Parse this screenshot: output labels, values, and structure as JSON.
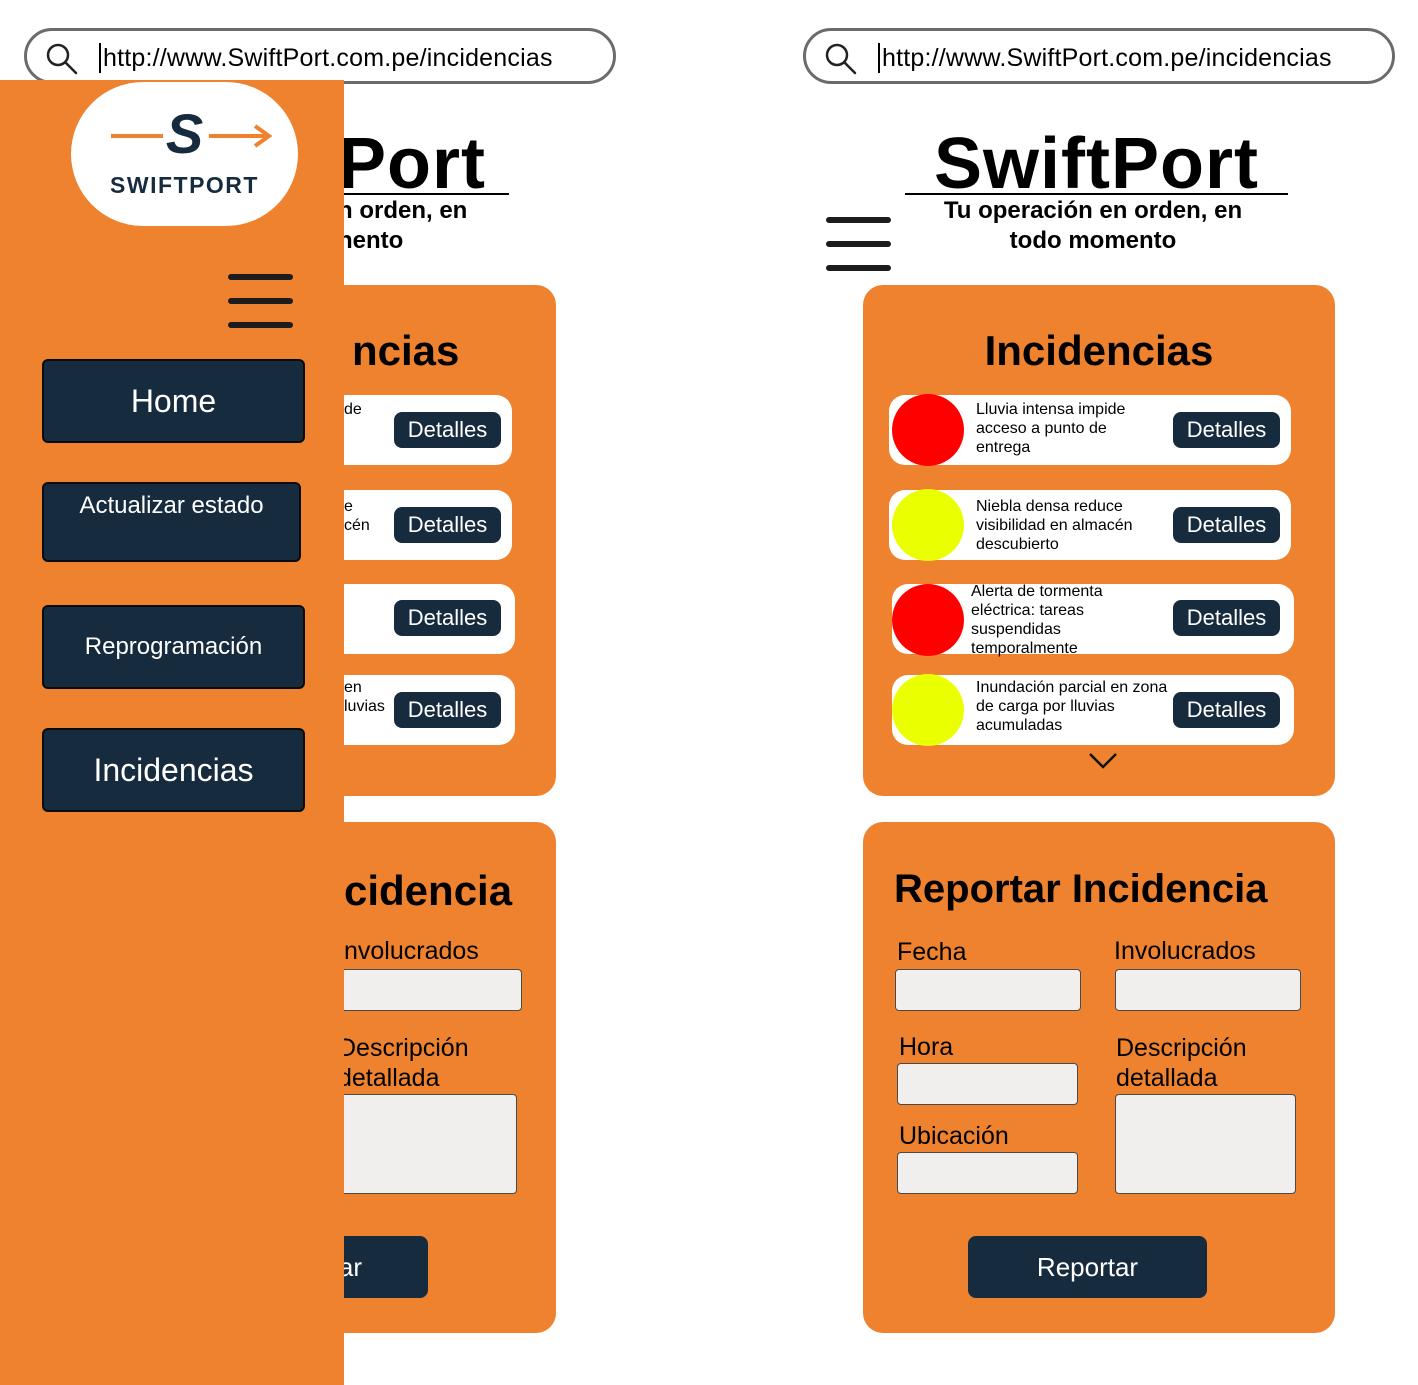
{
  "url": "http://www.SwiftPort.com.pe/incidencias",
  "brand": {
    "name": "SwiftPort",
    "tagline_line1": "Tu operación en orden, en",
    "tagline_line2": "todo momento",
    "logo_text": "SWIFTPORT",
    "logo_letter": "S"
  },
  "left_partial": {
    "brand": "Port",
    "tagline_line1": "n orden, en",
    "tagline_line2": "nento",
    "incidencias_title": "ncias",
    "row_fragments": [
      "de",
      "e",
      "cén",
      "en",
      "luvias"
    ],
    "report_title": "cidencia",
    "involucrados": "nvolucrados",
    "descripcion_line1": "Descripción",
    "descripcion_line2": "detallada",
    "report_button": "ar"
  },
  "side_menu": {
    "items": [
      {
        "label": "Home"
      },
      {
        "label": "Actualizar estado"
      },
      {
        "label": "Reprogramación"
      },
      {
        "label": "Incidencias"
      }
    ]
  },
  "incidencias": {
    "title": "Incidencias",
    "details_label": "Detalles",
    "items": [
      {
        "text": "Lluvia intensa impide acceso a punto de entrega",
        "severity_color": "#ff0000"
      },
      {
        "text": "Niebla densa reduce visibilidad en almacén descubierto",
        "severity_color": "#eaff00"
      },
      {
        "text": "Alerta de tormenta eléctrica: tareas suspendidas temporalmente",
        "severity_color": "#ff0000"
      },
      {
        "text": "Inundación parcial en zona de carga por lluvias acumuladas",
        "severity_color": "#eaff00"
      }
    ]
  },
  "report": {
    "title": "Reportar Incidencia",
    "fecha": "Fecha",
    "involucrados": "Involucrados",
    "hora": "Hora",
    "descripcion_line1": "Descripción",
    "descripcion_line2": "detallada",
    "ubicacion": "Ubicación",
    "button": "Reportar"
  },
  "colors": {
    "accent": "#ee822f",
    "dark_button": "#172b3e",
    "field_bg": "#f0efee"
  }
}
